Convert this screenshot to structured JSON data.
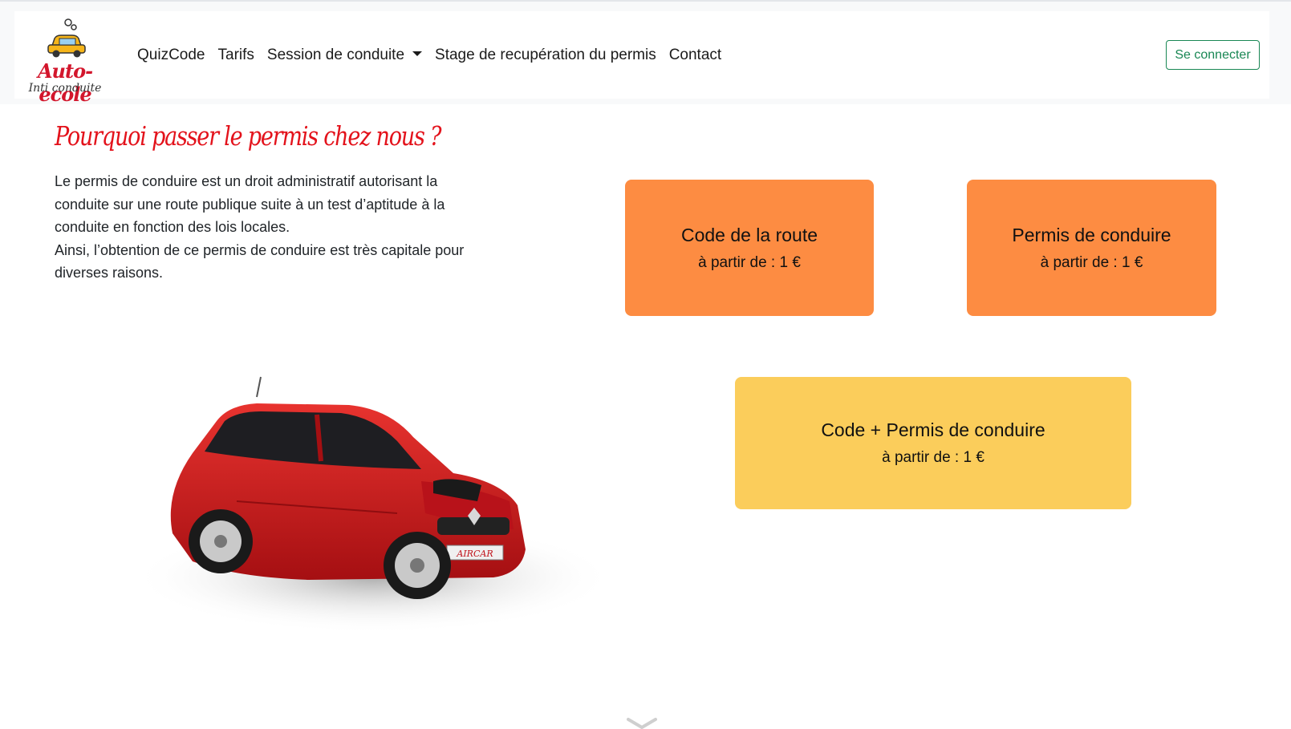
{
  "nav": {
    "brand": "Auto-ecole",
    "brand_tagline": "Inti conduite",
    "links": [
      "QuizCode",
      "Tarifs",
      "Session de conduite",
      "Stage de recupération du permis",
      "Contact"
    ],
    "login_label": "Se connecter"
  },
  "hero": {
    "headline": "Pourquoi passer le permis chez nous ?",
    "paragraphs": [
      "Le permis de conduire est un droit administratif autorisant la conduite sur une route publique suite à un test d’aptitude à la conduite en fonction des lois locales.",
      "Ainsi, l’obtention de ce permis de conduire est très capitale pour diverses raisons."
    ]
  },
  "car_plate": "AIRCAR",
  "offers": [
    {
      "title": "Code de la route",
      "price": "à partir de : 1 €"
    },
    {
      "title": "Permis de conduire",
      "price": "à partir de : 1 €"
    },
    {
      "title": "Code + Permis de conduire",
      "price": "à partir de : 1 €"
    }
  ],
  "colors": {
    "accent_orange": "#fd8c42",
    "accent_yellow": "#fbcd5b",
    "headline_red": "#e3121b",
    "login_green": "#198754"
  }
}
